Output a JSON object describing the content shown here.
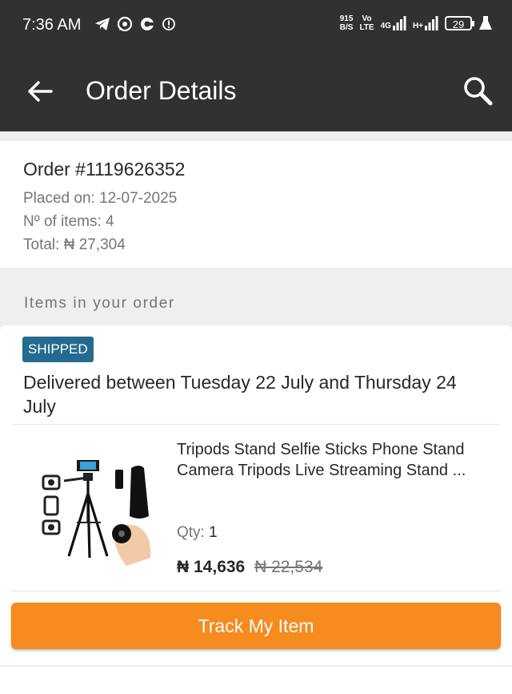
{
  "status_bar": {
    "time": "7:36 AM",
    "net_speed_value": "915",
    "net_speed_unit": "B/S",
    "volte_top": "Vo",
    "volte_bottom": "LTE",
    "network_1": "4G",
    "network_2": "H+",
    "battery": "29"
  },
  "header": {
    "title": "Order Details",
    "back_icon": "arrow-left-icon",
    "search_icon": "search-icon"
  },
  "order": {
    "number": "Order #1119626352",
    "placed_on": "Placed on: 12-07-2025",
    "items_count": "Nº of items: 4",
    "total": "Total: ₦ 27,304"
  },
  "items_section": {
    "label": "Items in your order"
  },
  "item": {
    "status_badge": "SHIPPED",
    "delivery_text": "Delivered between Tuesday 22 July and Thursday 24 July",
    "product_name": "Tripods Stand Selfie Sticks Phone Stand Camera Tripods Live Streaming Stand ...",
    "qty_label": "Qty:",
    "qty_value": "1",
    "price": "₦ 14,636",
    "old_price": "₦ 22,534",
    "track_button": "Track My Item"
  },
  "colors": {
    "header_bg": "#313133",
    "accent_orange": "#f68b1e",
    "badge_blue": "#246b8f"
  }
}
